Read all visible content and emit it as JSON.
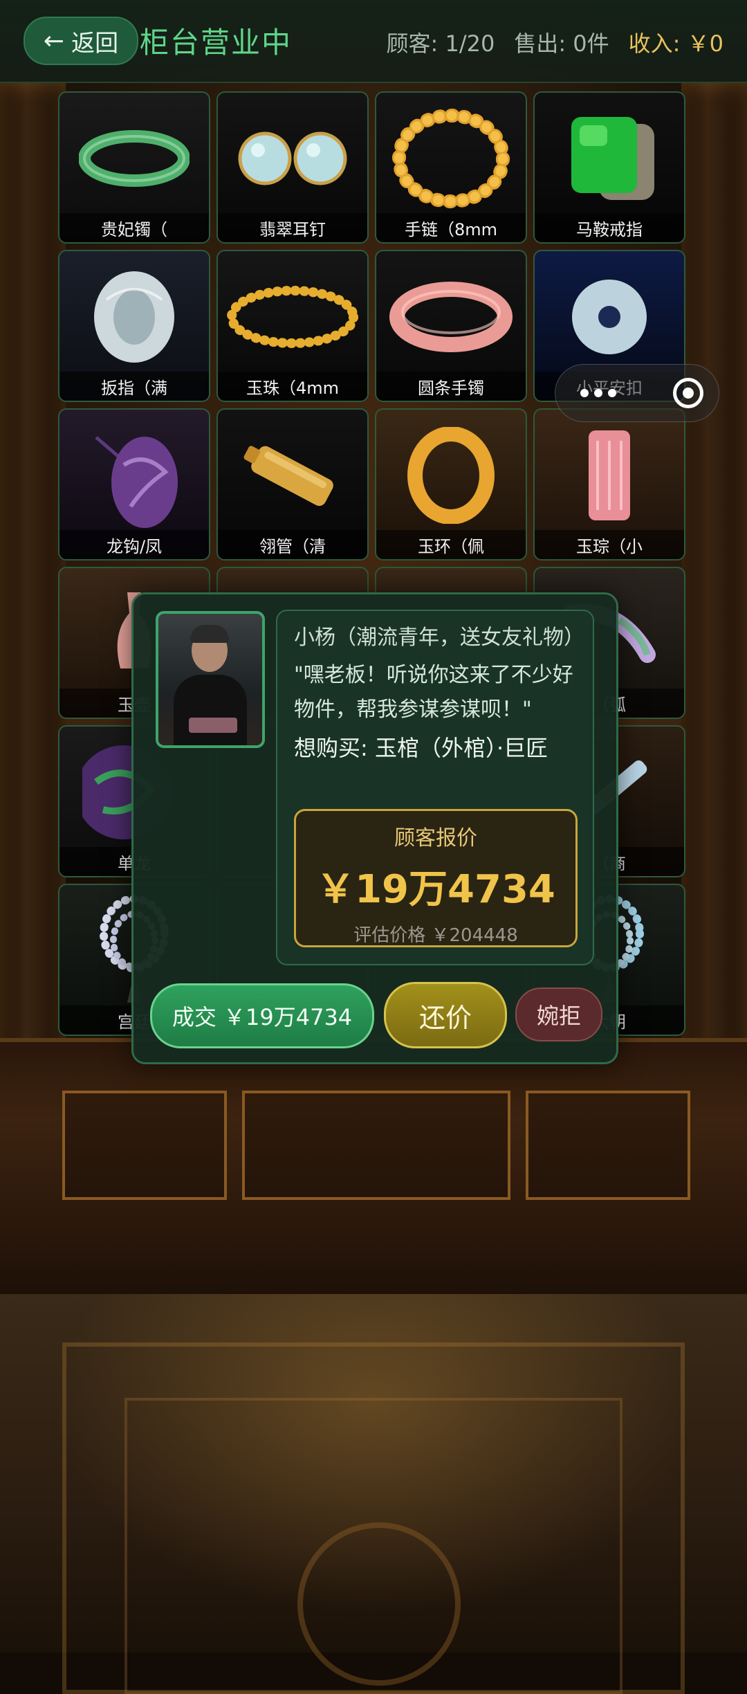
{
  "header": {
    "back_label": "返回",
    "title": "柜台营业中",
    "customers": "顾客: 1/20",
    "sold": "售出: 0件",
    "income": "收入: ￥0"
  },
  "items": [
    {
      "label": "贵妃镯（",
      "icon": "jade-bangle-icon"
    },
    {
      "label": "翡翠耳钉",
      "icon": "jade-earrings-icon"
    },
    {
      "label": "手链（8mm",
      "icon": "bead-bracelet-icon"
    },
    {
      "label": "马鞍戒指",
      "icon": "saddle-ring-icon"
    },
    {
      "label": "扳指（满",
      "icon": "thumb-ring-icon"
    },
    {
      "label": "玉珠（4mm",
      "icon": "small-bead-bracelet-icon"
    },
    {
      "label": "圆条手镯",
      "icon": "round-bangle-icon"
    },
    {
      "label": "小平安扣",
      "icon": "safety-buckle-icon"
    },
    {
      "label": "龙钩/凤",
      "icon": "dragon-pendant-icon"
    },
    {
      "label": "翎管（清",
      "icon": "feather-tube-icon"
    },
    {
      "label": "玉环（佩",
      "icon": "jade-ring-icon"
    },
    {
      "label": "玉琮（小",
      "icon": "jade-cong-icon"
    },
    {
      "label": "玉壶",
      "icon": "jade-vase-icon"
    },
    {
      "label": "",
      "icon": "item-icon"
    },
    {
      "label": "",
      "icon": "item-icon"
    },
    {
      "label": "（弧",
      "icon": "arc-pendant-icon"
    },
    {
      "label": "单龙",
      "icon": "single-dragon-icon"
    },
    {
      "label": "",
      "icon": "item-icon"
    },
    {
      "label": "",
      "icon": "item-icon"
    },
    {
      "label": "（商",
      "icon": "shang-item-icon"
    },
    {
      "label": "宫廷",
      "icon": "court-necklace-icon"
    },
    {
      "label": "",
      "icon": "item-icon"
    },
    {
      "label": "",
      "icon": "item-icon"
    },
    {
      "label": "大朝",
      "icon": "court-beads-icon"
    }
  ],
  "dialog": {
    "customer_name": "小杨（潮流青年，送女友礼物）",
    "quote": "\"嘿老板！听说你这来了不少好物件，帮我参谋参谋呗！\"",
    "wants": "想购买: 玉棺（外棺）·巨匠",
    "offer_label": "顾客报价",
    "offer_price": "￥19万4734",
    "estimate": "评估价格 ￥204448",
    "deal_button": "成交 ￥19万4734",
    "counter_button": "还价",
    "reject_button": "婉拒"
  }
}
